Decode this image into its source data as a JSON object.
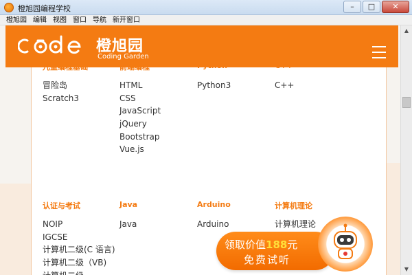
{
  "window": {
    "title": "橙旭园编程学校"
  },
  "menu": [
    "橙旭园",
    "编辑",
    "视图",
    "窗口",
    "导航",
    "新开窗口"
  ],
  "brand": {
    "name_cn": "橙旭园",
    "name_en": "Coding Garden",
    "logo_text": "code"
  },
  "columns_row1": [
    {
      "title": "儿童编程基础",
      "items": [
        "冒险岛",
        "Scratch3"
      ]
    },
    {
      "title": "前端编程",
      "items": [
        "HTML",
        "CSS",
        "JavaScript",
        "jQuery",
        "Bootstrap",
        "Vue.js"
      ]
    },
    {
      "title": "Python",
      "items": [
        "Python3"
      ]
    },
    {
      "title": "C++",
      "items": [
        "C++"
      ]
    }
  ],
  "columns_row2": [
    {
      "title": "认证与考试",
      "items": [
        "NOIP",
        "IGCSE",
        "计算机二级(C 语言)",
        "计算机二级（VB)",
        "计算机二级"
      ]
    },
    {
      "title": "Java",
      "items": [
        "Java"
      ]
    },
    {
      "title": "Arduino",
      "items": [
        "Arduino"
      ]
    },
    {
      "title": "计算机理论",
      "items": [
        "计算机理论"
      ]
    }
  ],
  "cta": {
    "prefix": "领取价值",
    "price": "188",
    "suffix": "元",
    "line2": "免费试听"
  },
  "colors": {
    "brand_orange": "#f47b12",
    "price_yellow": "#ffe03a"
  }
}
